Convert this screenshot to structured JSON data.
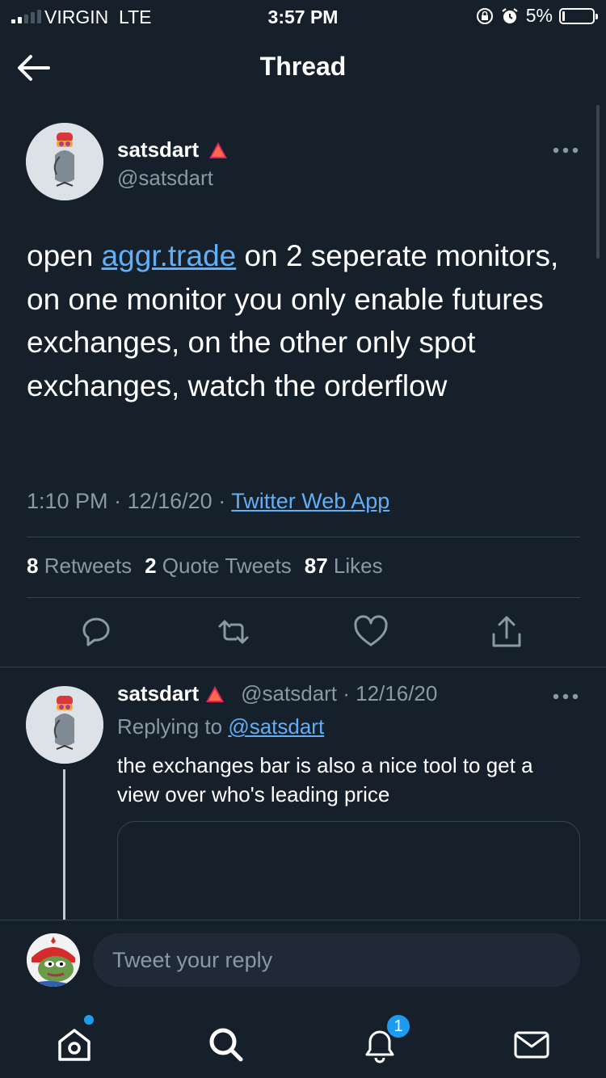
{
  "status_bar": {
    "carrier": "VIRGIN  LTE",
    "time": "3:57 PM",
    "battery_percent": "5%",
    "battery_level": 0.05
  },
  "nav": {
    "title": "Thread",
    "back_icon": "arrow-left-icon"
  },
  "main_tweet": {
    "name": "satsdart",
    "handle": "@satsdart",
    "text_before_link": "open ",
    "link_text": "aggr.trade",
    "text_after_link": " on 2 seperate monitors, on one monitor you only enable futures exchanges, on the other only spot exchanges, watch the orderflow",
    "time": "1:10 PM",
    "date": "12/16/20",
    "source": "Twitter Web App",
    "retweets_count": "8",
    "retweets_label": "Retweets",
    "quotes_count": "2",
    "quotes_label": "Quote Tweets",
    "likes_count": "87",
    "likes_label": "Likes"
  },
  "reply_tweet": {
    "name": "satsdart",
    "handle_date": "@satsdart · 12/16/20",
    "replying_prefix": "Replying to",
    "replying_to": "@satsdart",
    "text": "the exchanges bar is also a nice tool to get a view over who's leading price"
  },
  "composer": {
    "placeholder": "Tweet your reply"
  },
  "tab_bar": {
    "notification_badge": "1"
  },
  "colors": {
    "background": "#15202b",
    "link": "#63aef5",
    "accent": "#1d9bf0",
    "muted": "#8b98a5",
    "verified_badge": "#e0245e"
  }
}
